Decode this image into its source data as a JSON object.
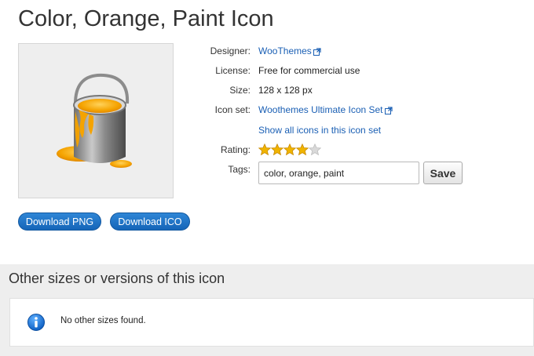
{
  "page": {
    "title": "Color, Orange, Paint Icon"
  },
  "details": {
    "designer_label": "Designer:",
    "designer_value": "WooThemes",
    "license_label": "License:",
    "license_value": "Free for commercial use",
    "size_label": "Size:",
    "size_value": "128 x 128 px",
    "iconset_label": "Icon set:",
    "iconset_value": "Woothemes Ultimate Icon Set",
    "show_all_link": "Show all icons in this icon set",
    "rating_label": "Rating:",
    "rating_value": 4,
    "rating_max": 5,
    "tags_label": "Tags:",
    "tags_value": "color, orange, paint",
    "save_label": "Save"
  },
  "downloads": {
    "png_label": "Download PNG",
    "ico_label": "Download ICO"
  },
  "other_sizes": {
    "heading": "Other sizes or versions of this icon",
    "message": "No other sizes found."
  },
  "icons": [
    "external-link-icon",
    "star-icon",
    "info-icon",
    "paint-bucket-icon"
  ],
  "colors": {
    "link": "#1a5fb4",
    "button": "#1f74c6",
    "star": "#f0b400",
    "section_bg": "#eeeeee"
  }
}
